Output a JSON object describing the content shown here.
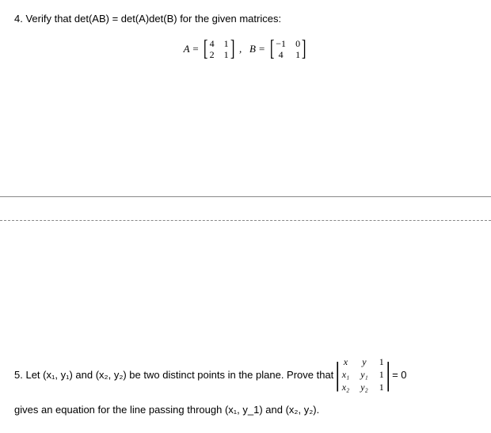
{
  "problem4": {
    "number": "4.",
    "text": "Verify that det(AB) = det(A)det(B) for the given matrices:",
    "labelA": "A =",
    "comma": ",",
    "labelB": "B =",
    "matrixA": {
      "r1c1": "4",
      "r1c2": "1",
      "r2c1": "2",
      "r2c2": "1"
    },
    "matrixB": {
      "r1c1": "−1",
      "r1c2": "0",
      "r2c1": "4",
      "r2c2": "1"
    }
  },
  "problem5": {
    "number": "5.",
    "textBefore": "Let (x₁, y₁) and (x₂, y₂) be two distinct points in the plane.  Prove that ",
    "eqZero": " = 0",
    "det": {
      "r1c1": "x",
      "r1c2": "y",
      "r1c3": "1",
      "r2c1": "x₁",
      "r2c2": "y₁",
      "r2c3": "1",
      "r3c1": "x₂",
      "r3c2": "y₂",
      "r3c3": "1"
    },
    "textAfter": "gives an equation for the line passing through (x₁, y_1) and (x₂, y₂)."
  }
}
